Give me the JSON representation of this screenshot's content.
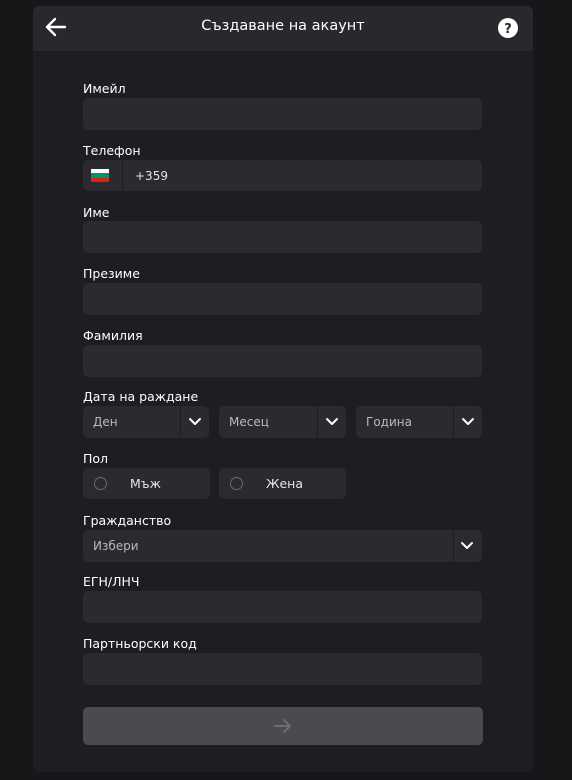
{
  "header": {
    "title": "Създаване на акаунт"
  },
  "form": {
    "email_label": "Имейл",
    "email_value": "",
    "phone_label": "Телефон",
    "phone_value": "+359",
    "flag_icon": "bulgaria-flag-icon",
    "first_name_label": "Име",
    "first_name_value": "",
    "middle_name_label": "Презиме",
    "middle_name_value": "",
    "last_name_label": "Фамилия",
    "last_name_value": "",
    "birth_date_label": "Дата на раждане",
    "day_placeholder": "Ден",
    "month_placeholder": "Месец",
    "year_placeholder": "Година",
    "gender_label": "Пол",
    "gender_male": "Мъж",
    "gender_female": "Жена",
    "citizenship_label": "Гражданство",
    "citizenship_value": "Избери",
    "egn_label": "ЕГН/ЛНЧ",
    "egn_value": "",
    "partner_code_label": "Партньорски код",
    "partner_code_value": ""
  },
  "colors": {
    "background": "#17171a",
    "panel": "#1e1e22",
    "header": "#28282d",
    "field": "#2a2a2f",
    "submit_disabled": "#4a4a50"
  }
}
